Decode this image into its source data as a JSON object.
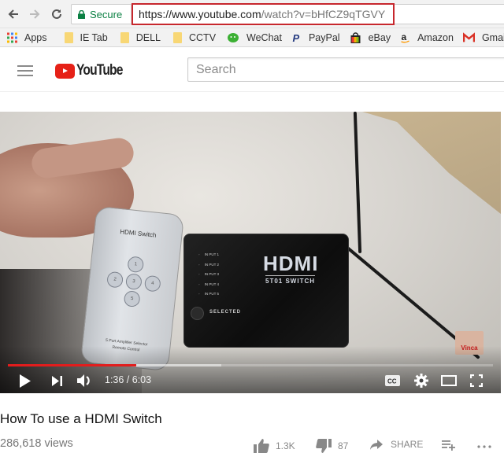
{
  "browser": {
    "secure_label": "Secure",
    "url_host": "https://www.youtube.com",
    "url_path": "/watch?v=bHfCZ9qTGVY",
    "bookmarks": [
      {
        "label": "Apps",
        "icon": "apps-grid-icon"
      },
      {
        "label": "IE Tab",
        "icon": "folder-icon"
      },
      {
        "label": "DELL",
        "icon": "folder-icon"
      },
      {
        "label": "CCTV",
        "icon": "folder-icon"
      },
      {
        "label": "WeChat",
        "icon": "wechat-icon"
      },
      {
        "label": "PayPal",
        "icon": "paypal-icon"
      },
      {
        "label": "eBay",
        "icon": "ebay-icon"
      },
      {
        "label": "Amazon",
        "icon": "amazon-icon"
      },
      {
        "label": "Gmail",
        "icon": "gmail-icon"
      }
    ]
  },
  "youtube": {
    "logo_text": "YouTube",
    "search_placeholder": "Search"
  },
  "video": {
    "remote_title": "HDMI Switch",
    "remote_footer_line1": "5 Port Amplifier Selector",
    "remote_footer_line2": "Remote Control",
    "remote_buttons": [
      "1",
      "2",
      "3",
      "4",
      "5"
    ],
    "switch_logo": "HDMI",
    "switch_sub": "5T01 SWITCH",
    "switch_inputs": [
      "IN PUT 1",
      "IN PUT 2",
      "IN PUT 3",
      "IN PUT 4",
      "IN PUT 5"
    ],
    "switch_selected": "SELECTED",
    "watermark": "Vinca",
    "current_time": "1:36",
    "duration": "6:03",
    "time_display": "1:36 / 6:03",
    "played_fraction": 0.265,
    "loaded_fraction": 0.44,
    "accent_color": "#e21d1d",
    "title": "How To use a HDMI Switch",
    "views": "286,618 views",
    "likes": "1.3K",
    "dislikes": "87",
    "share_label": "SHARE"
  }
}
